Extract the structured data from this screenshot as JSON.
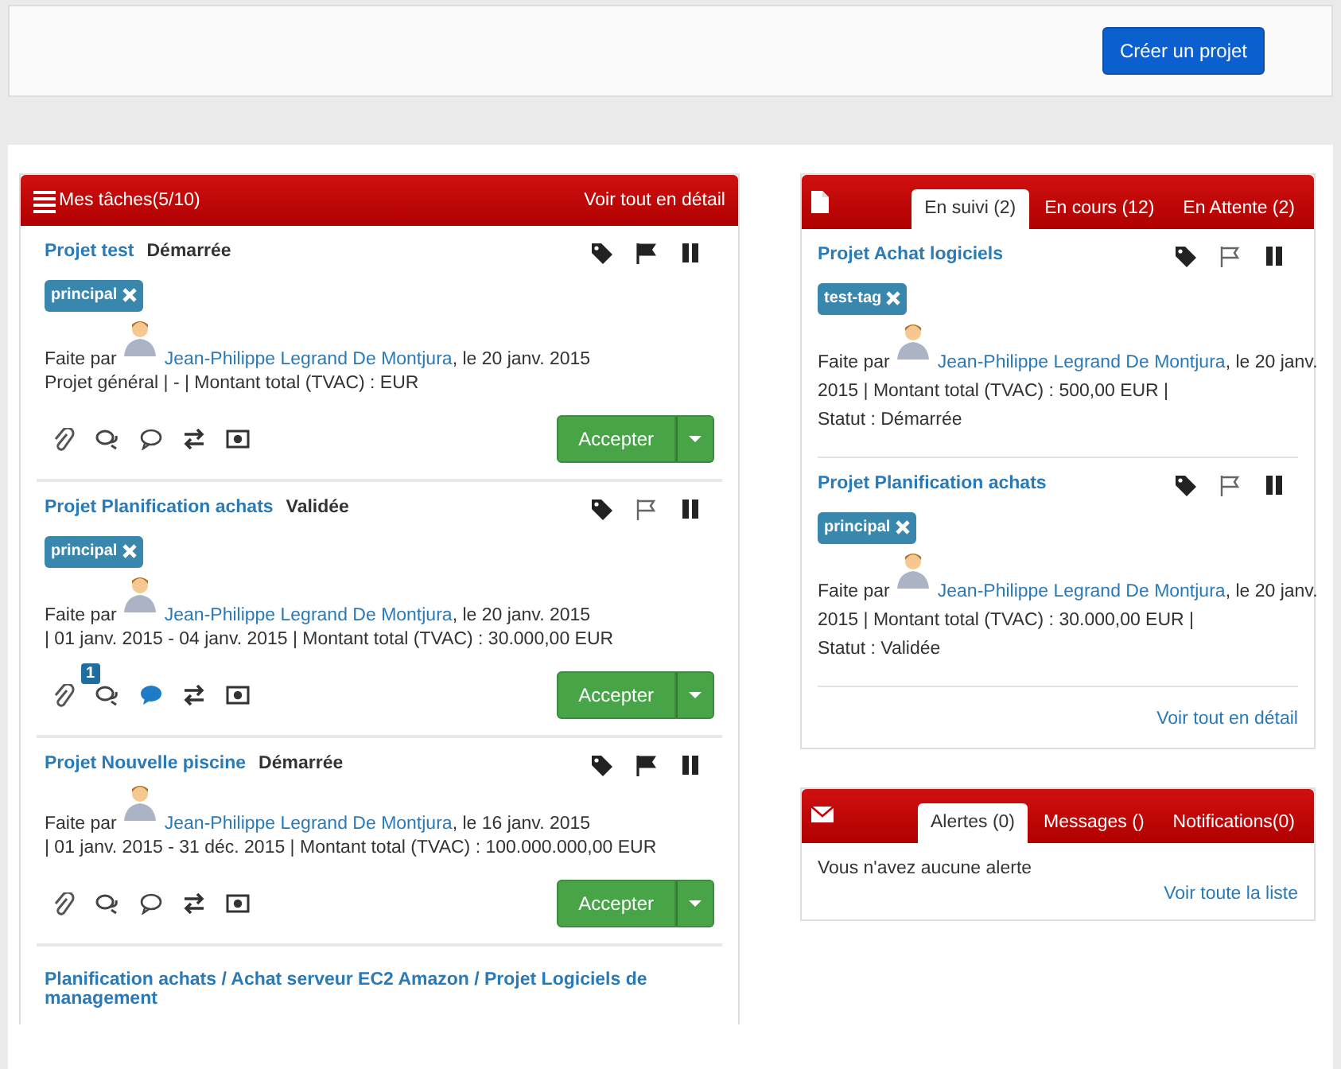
{
  "header": {
    "create_button": "Créer un projet"
  },
  "tasks_panel": {
    "title": "Mes tâches(5/10)",
    "detail_link": "Voir tout en détail",
    "tasks": [
      {
        "kind": "task",
        "title": "Projet test",
        "status": "Démarrée",
        "flagged": true,
        "tags": [
          "principal"
        ],
        "by_label": "Faite par",
        "author": "Jean-Philippe Legrand De Montjura",
        "date": ", le 20 janv. 2015",
        "details": "Projet général |  -  | Montant total (TVAC) :  EUR",
        "comment_unread": false,
        "accept_label": "Accepter"
      },
      {
        "kind": "task",
        "title": "Projet Planification achats",
        "status": "Validée",
        "flagged": false,
        "tags": [
          "principal"
        ],
        "by_label": "Faite par",
        "author": "Jean-Philippe Legrand De Montjura",
        "date": ", le 20 janv. 2015",
        "details": "| 01 janv. 2015 - 04 janv. 2015 | Montant total (TVAC) : 30.000,00 EUR",
        "comment_badge": "1",
        "comment_unread": true,
        "accept_label": "Accepter"
      },
      {
        "kind": "task",
        "title": "Projet Nouvelle piscine",
        "status": "Démarrée",
        "flagged": true,
        "by_label": "Faite par",
        "author": "Jean-Philippe Legrand De Montjura",
        "date": ", le 16 janv. 2015",
        "details": "| 01 janv. 2015 - 31 déc. 2015 | Montant total (TVAC) : 100.000.000,00 EUR",
        "comment_unread": false,
        "accept_label": "Accepter"
      },
      {
        "kind": "path",
        "title": "Planification achats / Achat serveur EC2 Amazon / Projet Logiciels de management"
      }
    ]
  },
  "followed_panel": {
    "tabs": [
      {
        "label": "En suivi (2)",
        "selected": true
      },
      {
        "label": "En cours (12)",
        "selected": false
      },
      {
        "label": "En Attente (2)",
        "selected": false
      }
    ],
    "items": [
      {
        "title": "Projet Achat logiciels",
        "flagged": false,
        "tags": [
          "test-tag"
        ],
        "by_label": "Faite par",
        "author": "Jean-Philippe Legrand De Montjura",
        "date": ", le 20 janv.",
        "details": "2015 | Montant total (TVAC) : 500,00 EUR |",
        "status_line": "Statut : Démarrée"
      },
      {
        "title": "Projet Planification achats",
        "flagged": false,
        "tags": [
          "principal"
        ],
        "by_label": "Faite par",
        "author": "Jean-Philippe Legrand De Montjura",
        "date": ", le 20 janv.",
        "details": "2015 | Montant total (TVAC) : 30.000,00 EUR |",
        "status_line": "Statut : Validée"
      }
    ],
    "detail_link": "Voir tout en détail"
  },
  "alerts_panel": {
    "tabs": [
      {
        "label": "Alertes (0)",
        "selected": true
      },
      {
        "label": "Messages ()",
        "selected": false
      },
      {
        "label": "Notifications(0)",
        "selected": false
      }
    ],
    "message": "Vous n'avez aucune alerte",
    "list_link": "Voir toute la liste"
  }
}
